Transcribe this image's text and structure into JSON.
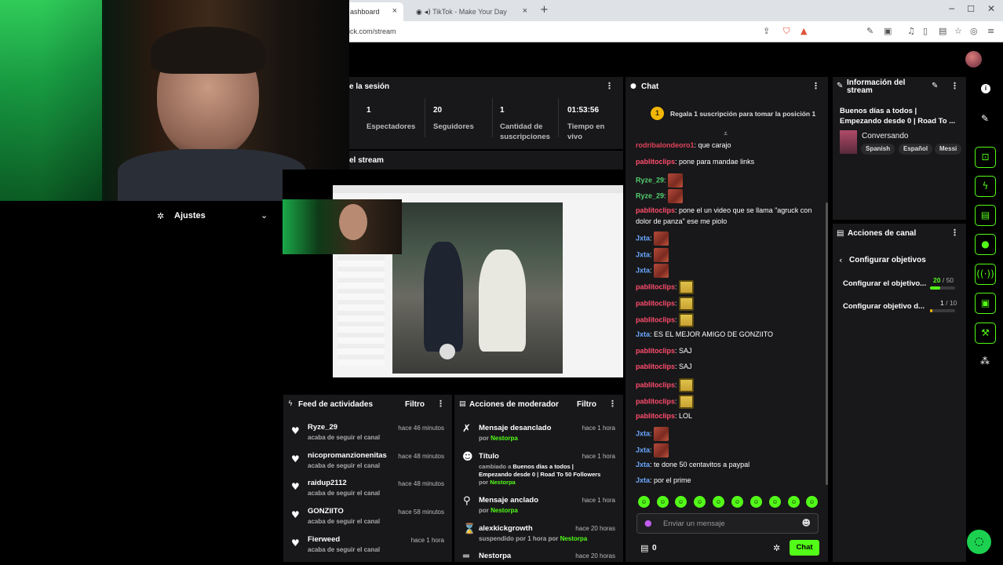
{
  "browser": {
    "tab1_title": "ashboard",
    "tab2_title": "TikTok - Make Your Day",
    "url": "ick.com/stream"
  },
  "session": {
    "title": "e la sesión",
    "stats": [
      {
        "value": "1",
        "label": "Espectadores"
      },
      {
        "value": "20",
        "label": "Seguidores"
      },
      {
        "value": "1",
        "label": "Cantidad de suscripciones"
      },
      {
        "value": "01:53:56",
        "label": "Tiempo en vivo"
      }
    ]
  },
  "preview": {
    "title": "el stream"
  },
  "settings": {
    "label": "Ajustes"
  },
  "chat": {
    "title": "Chat",
    "pinned_rank": "1",
    "pinned_text": "Regala 1 suscripción para tomar la posición 1",
    "messages": [
      {
        "user": "rodribalondeoro1",
        "text": ": que carajo",
        "color": "red"
      },
      {
        "user": "pablitoclips",
        "text": ": pone para mandae links",
        "color": "pink"
      },
      {
        "user": "Ryze_29",
        "text": ":",
        "emote": "red",
        "color": "green"
      },
      {
        "user": "Ryze_29",
        "text": ":",
        "emote": "red",
        "color": "green"
      },
      {
        "user": "pablitoclips",
        "text": ": pone el un video que se llama \"agruck con",
        "color": "pink"
      },
      {
        "user": "",
        "text": "dolor de panza\" ese me piolo",
        "color": "pink"
      },
      {
        "user": "Jxta",
        "text": ":",
        "emote": "red",
        "color": "blue"
      },
      {
        "user": "Jxta",
        "text": ":",
        "emote": "red",
        "color": "blue"
      },
      {
        "user": "Jxta",
        "text": ":",
        "emote": "red",
        "color": "blue"
      },
      {
        "user": "pablitoclips",
        "text": ":",
        "emote": "sponge",
        "color": "pink"
      },
      {
        "user": "pablitoclips",
        "text": ":",
        "emote": "sponge",
        "color": "pink"
      },
      {
        "user": "pablitoclips",
        "text": ":",
        "emote": "sponge",
        "color": "pink"
      },
      {
        "user": "Jxta",
        "text": ": ES EL MEJOR AMIGO DE GONZIITO",
        "color": "blue"
      },
      {
        "user": "pablitoclips",
        "text": ": SAJ",
        "color": "pink"
      },
      {
        "user": "pablitoclips",
        "text": ": SAJ",
        "color": "pink"
      },
      {
        "user": "pablitoclips",
        "text": ":",
        "emote": "sponge",
        "color": "pink"
      },
      {
        "user": "pablitoclips",
        "text": ":",
        "emote": "sponge",
        "color": "pink"
      },
      {
        "user": "pablitoclips",
        "text": ": LOL",
        "color": "pink"
      },
      {
        "user": "Jxta",
        "text": ":",
        "emote": "red",
        "color": "blue"
      },
      {
        "user": "Jxta",
        "text": ":",
        "emote": "red",
        "color": "blue"
      },
      {
        "user": "Jxta",
        "text": ": te done 50 centavitos a paypal",
        "color": "blue"
      },
      {
        "user": "Jxta",
        "text": ": por el prime",
        "color": "blue"
      }
    ],
    "input_placeholder": "Enviar un mensaje",
    "points": "0",
    "send_label": "Chat"
  },
  "stream_info": {
    "title_line1": "Información del",
    "title_line2": "stream",
    "stream_title_1": "Buenos días a todos |",
    "stream_title_2": "Empezando desde 0 | Road To ...",
    "category": "Conversando",
    "tags": [
      "Spanish",
      "Español",
      "Messi"
    ]
  },
  "channel_actions": {
    "title": "Acciones de canal",
    "back_label": "Configurar objetivos",
    "goals": [
      {
        "label": "Configurar el objetivo...",
        "current": "20",
        "target": "/ 50",
        "fraction": 0.4
      },
      {
        "label": "Configurar objetivo d...",
        "current": "1",
        "target": "/ 10",
        "fraction": 0.1
      }
    ]
  },
  "activity": {
    "title": "Feed de actividades",
    "filter_label": "Filtro",
    "items": [
      {
        "name": "Ryze_29",
        "sub": "acaba de seguir el canal",
        "time": "hace 46 minutos"
      },
      {
        "name": "nicopromanzionenitas",
        "sub": "acaba de seguir el canal",
        "time": "hace 48 minutos"
      },
      {
        "name": "raidup2112",
        "sub": "acaba de seguir el canal",
        "time": "hace 48 minutos"
      },
      {
        "name": "GONZIITO",
        "sub": "acaba de seguir el canal",
        "time": "hace 58 minutos"
      },
      {
        "name": "Fierweed",
        "sub": "acaba de seguir el canal",
        "time": "hace 1 hora"
      }
    ]
  },
  "mod": {
    "title": "Acciones de moderador",
    "filter_label": "Filtro",
    "items": [
      {
        "name": "Mensaje desanclado",
        "time": "hace 1 hora",
        "by": "por",
        "user": "Nestorpa"
      },
      {
        "name": "Título",
        "time": "hace 1 hora",
        "changed": "cambiado a",
        "value1": "Buenos días a todos |",
        "value2": "Empezando desde 0 | Road To 50 Followers",
        "by": "por",
        "user": "Nestorpa"
      },
      {
        "name": "Mensaje anclado",
        "time": "hace 1 hora",
        "by": "por",
        "user": "Nestorpa"
      },
      {
        "name": "alexkickgrowth",
        "time": "hace 20 horas",
        "sub": "suspendido por 1 hora por",
        "user": "Nestorpa"
      },
      {
        "name": "Nestorpa",
        "time": "hace 20 horas"
      }
    ]
  },
  "colors": {
    "accent": "#53fc18",
    "panel": "#18181a",
    "background": "#000000"
  }
}
